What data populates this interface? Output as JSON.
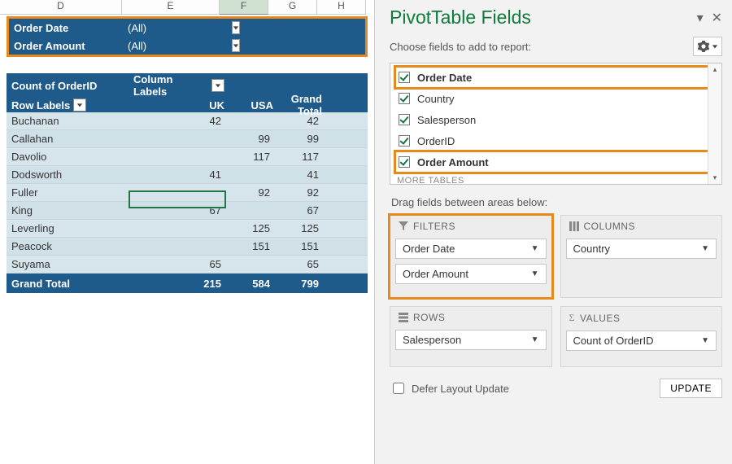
{
  "columns_header": [
    "D",
    "E",
    "F",
    "G",
    "H"
  ],
  "active_col_index": 2,
  "report_filters": [
    {
      "label": "Order Date",
      "value": "(All)"
    },
    {
      "label": "Order Amount",
      "value": "(All)"
    }
  ],
  "pivot": {
    "data_label": "Count of OrderID",
    "column_labels_label": "Column Labels",
    "row_labels_label": "Row Labels",
    "columns": [
      "UK",
      "USA"
    ],
    "grand_total_label": "Grand Total",
    "rows": [
      {
        "name": "Buchanan",
        "vals": [
          42,
          null
        ],
        "total": 42
      },
      {
        "name": "Callahan",
        "vals": [
          null,
          99
        ],
        "total": 99
      },
      {
        "name": "Davolio",
        "vals": [
          null,
          117
        ],
        "total": 117
      },
      {
        "name": "Dodsworth",
        "vals": [
          41,
          null
        ],
        "total": 41
      },
      {
        "name": "Fuller",
        "vals": [
          null,
          92
        ],
        "total": 92
      },
      {
        "name": "King",
        "vals": [
          67,
          null
        ],
        "total": 67
      },
      {
        "name": "Leverling",
        "vals": [
          null,
          125
        ],
        "total": 125
      },
      {
        "name": "Peacock",
        "vals": [
          null,
          151
        ],
        "total": 151
      },
      {
        "name": "Suyama",
        "vals": [
          65,
          null
        ],
        "total": 65
      }
    ],
    "totals": {
      "vals": [
        215,
        584
      ],
      "grand": 799
    }
  },
  "pane": {
    "title": "PivotTable Fields",
    "choose_text": "Choose fields to add to report:",
    "fields": [
      {
        "name": "Order Date",
        "checked": true,
        "bold": true,
        "highlight": true
      },
      {
        "name": "Country",
        "checked": true,
        "bold": false,
        "highlight": false
      },
      {
        "name": "Salesperson",
        "checked": true,
        "bold": false,
        "highlight": false
      },
      {
        "name": "OrderID",
        "checked": true,
        "bold": false,
        "highlight": false
      },
      {
        "name": "Order Amount",
        "checked": true,
        "bold": true,
        "highlight": true
      }
    ],
    "more_tables": "MORE TABLES",
    "drag_hint": "Drag fields between areas below:",
    "areas": {
      "filters": {
        "title": "FILTERS",
        "items": [
          "Order Date",
          "Order Amount"
        ]
      },
      "columns": {
        "title": "COLUMNS",
        "items": [
          "Country"
        ]
      },
      "rows": {
        "title": "ROWS",
        "items": [
          "Salesperson"
        ]
      },
      "values": {
        "title": "VALUES",
        "items": [
          "Count of OrderID"
        ]
      }
    },
    "defer_label": "Defer Layout Update",
    "update_label": "UPDATE"
  },
  "chart_data": {
    "type": "table",
    "title": "Count of OrderID",
    "row_field": "Salesperson",
    "column_field": "Country",
    "categories": [
      "UK",
      "USA"
    ],
    "series": [
      {
        "name": "Buchanan",
        "values": [
          42,
          null
        ]
      },
      {
        "name": "Callahan",
        "values": [
          null,
          99
        ]
      },
      {
        "name": "Davolio",
        "values": [
          null,
          117
        ]
      },
      {
        "name": "Dodsworth",
        "values": [
          41,
          null
        ]
      },
      {
        "name": "Fuller",
        "values": [
          null,
          92
        ]
      },
      {
        "name": "King",
        "values": [
          67,
          null
        ]
      },
      {
        "name": "Leverling",
        "values": [
          null,
          125
        ]
      },
      {
        "name": "Peacock",
        "values": [
          null,
          151
        ]
      },
      {
        "name": "Suyama",
        "values": [
          65,
          null
        ]
      }
    ],
    "column_totals": [
      215,
      584
    ],
    "grand_total": 799
  }
}
